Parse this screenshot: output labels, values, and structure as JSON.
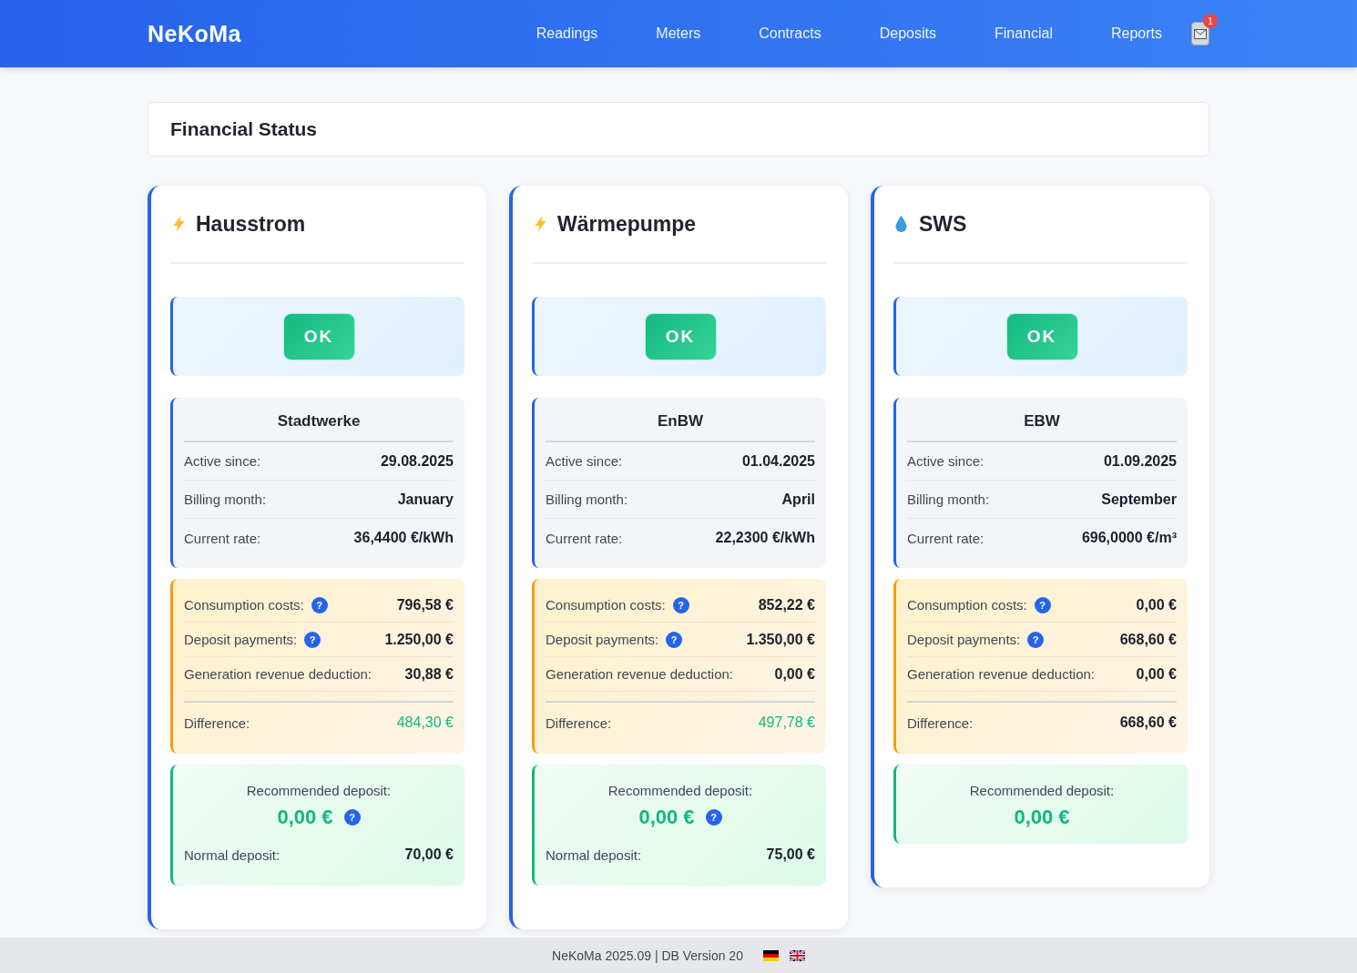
{
  "header": {
    "brand": "NeKoMa",
    "nav": [
      {
        "label": "Readings",
        "selected": false
      },
      {
        "label": "Meters",
        "selected": false
      },
      {
        "label": "Contracts",
        "selected": false
      },
      {
        "label": "Deposits",
        "selected": false
      },
      {
        "label": "Financial",
        "selected": false
      },
      {
        "label": "Reports",
        "selected": false
      }
    ],
    "notification_count": "1"
  },
  "page_title": "Financial Status",
  "cards": [
    {
      "kind": "electricity",
      "title": "Hausstrom",
      "status": "OK",
      "provider": "Stadtwerke",
      "details": [
        {
          "label": "Active since:",
          "value": "29.08.2025"
        },
        {
          "label": "Billing month:",
          "value": "January"
        },
        {
          "label": "Current rate:",
          "value": "36,4400 €/kWh"
        }
      ],
      "costs": [
        {
          "label": "Consumption costs:",
          "help": "?",
          "value": "796,58 €"
        },
        {
          "label": "Deposit payments:",
          "help": "?",
          "value": "1.250,00 €"
        },
        {
          "label": "Generation revenue deduction:",
          "value": "30,88 €"
        }
      ],
      "difference": {
        "label": "Difference:",
        "value": "484,30 €",
        "positive": true
      },
      "recommended": {
        "label": "Recommended deposit:",
        "value": "0,00 €",
        "help": "?"
      },
      "normal": {
        "label": "Normal deposit:",
        "value": "70,00 €"
      }
    },
    {
      "kind": "electricity",
      "title": "Wärmepumpe",
      "status": "OK",
      "provider": "EnBW",
      "details": [
        {
          "label": "Active since:",
          "value": "01.04.2025"
        },
        {
          "label": "Billing month:",
          "value": "April"
        },
        {
          "label": "Current rate:",
          "value": "22,2300 €/kWh"
        }
      ],
      "costs": [
        {
          "label": "Consumption costs:",
          "help": "?",
          "value": "852,22 €"
        },
        {
          "label": "Deposit payments:",
          "help": "?",
          "value": "1.350,00 €"
        },
        {
          "label": "Generation revenue deduction:",
          "value": "0,00 €"
        }
      ],
      "difference": {
        "label": "Difference:",
        "value": "497,78 €",
        "positive": true
      },
      "recommended": {
        "label": "Recommended deposit:",
        "value": "0,00 €",
        "help": "?"
      },
      "normal": {
        "label": "Normal deposit:",
        "value": "75,00 €"
      }
    },
    {
      "kind": "water",
      "title": "SWS",
      "status": "OK",
      "provider": "EBW",
      "details": [
        {
          "label": "Active since:",
          "value": "01.09.2025"
        },
        {
          "label": "Billing month:",
          "value": "September"
        },
        {
          "label": "Current rate:",
          "value": "696,0000 €/m³"
        }
      ],
      "costs": [
        {
          "label": "Consumption costs:",
          "help": "?",
          "value": "0,00 €"
        },
        {
          "label": "Deposit payments:",
          "help": "?",
          "value": "668,60 €"
        },
        {
          "label": "Generation revenue deduction:",
          "value": "0,00 €"
        }
      ],
      "difference": {
        "label": "Difference:",
        "value": "668,60 €",
        "positive": false
      },
      "recommended": {
        "label": "Recommended deposit:",
        "value": "0,00 €"
      }
    }
  ],
  "footer": {
    "text": "NeKoMa 2025.09 | DB Version 20",
    "languages": [
      {
        "kind": "de"
      },
      {
        "kind": "en"
      }
    ]
  }
}
